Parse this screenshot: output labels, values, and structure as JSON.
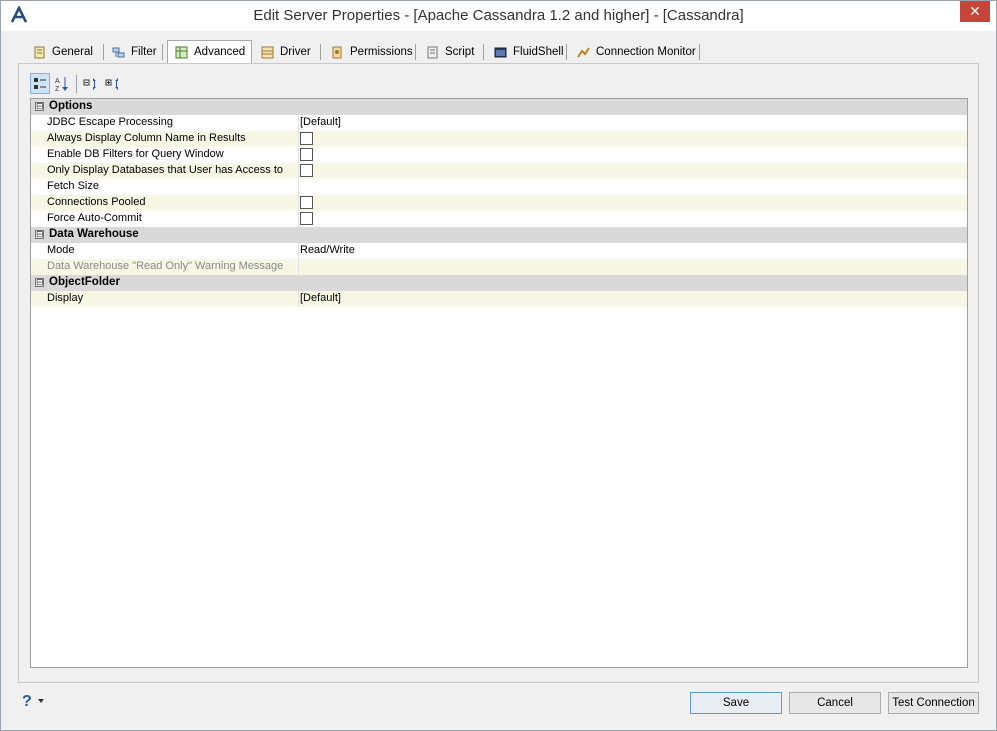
{
  "window": {
    "title": "Edit Server Properties - [Apache Cassandra 1.2 and higher] - [Cassandra]",
    "close_label": "✕"
  },
  "tabs": [
    {
      "label": "General",
      "icon": "general-icon"
    },
    {
      "label": "Filter",
      "icon": "filter-icon"
    },
    {
      "label": "Advanced",
      "icon": "advanced-icon",
      "active": true
    },
    {
      "label": "Driver",
      "icon": "driver-icon"
    },
    {
      "label": "Permissions",
      "icon": "permissions-icon"
    },
    {
      "label": "Script",
      "icon": "script-icon"
    },
    {
      "label": "FluidShell",
      "icon": "fluidshell-icon"
    },
    {
      "label": "Connection Monitor",
      "icon": "connection-monitor-icon"
    }
  ],
  "toolbar": {
    "buttons": [
      "categorized-view-icon",
      "alphabetical-sort-icon",
      "expand-all-icon",
      "collapse-all-icon"
    ]
  },
  "grid": {
    "categories": [
      {
        "name": "Options",
        "toggle": "⊟",
        "properties": [
          {
            "name": "JDBC Escape Processing",
            "type": "text",
            "value": "[Default]"
          },
          {
            "name": "Always Display Column Name in Results",
            "type": "checkbox",
            "checked": false
          },
          {
            "name": "Enable DB Filters for Query Window",
            "type": "checkbox",
            "checked": false
          },
          {
            "name": "Only Display Databases that User has Access to",
            "type": "checkbox",
            "checked": false
          },
          {
            "name": "Fetch Size",
            "type": "text",
            "value": ""
          },
          {
            "name": "Connections Pooled",
            "type": "checkbox",
            "checked": false
          },
          {
            "name": "Force Auto-Commit",
            "type": "checkbox",
            "checked": false
          }
        ]
      },
      {
        "name": "Data Warehouse",
        "toggle": "⊟",
        "properties": [
          {
            "name": "Mode",
            "type": "text",
            "value": "Read/Write"
          },
          {
            "name": "Data Warehouse \"Read Only\" Warning Message",
            "type": "text",
            "value": "",
            "disabled": true
          }
        ]
      },
      {
        "name": "ObjectFolder",
        "toggle": "⊟",
        "properties": [
          {
            "name": "Display",
            "type": "text",
            "value": "[Default]"
          }
        ]
      }
    ]
  },
  "footer": {
    "help_label": "?",
    "save_label": "Save",
    "cancel_label": "Cancel",
    "test_connection_label": "Test Connection"
  },
  "colors": {
    "close_button": "#c7443a",
    "category_row": "#d9d9d9",
    "alt_row": "#f7f7e6",
    "default_button_border": "#5b9bd5"
  }
}
